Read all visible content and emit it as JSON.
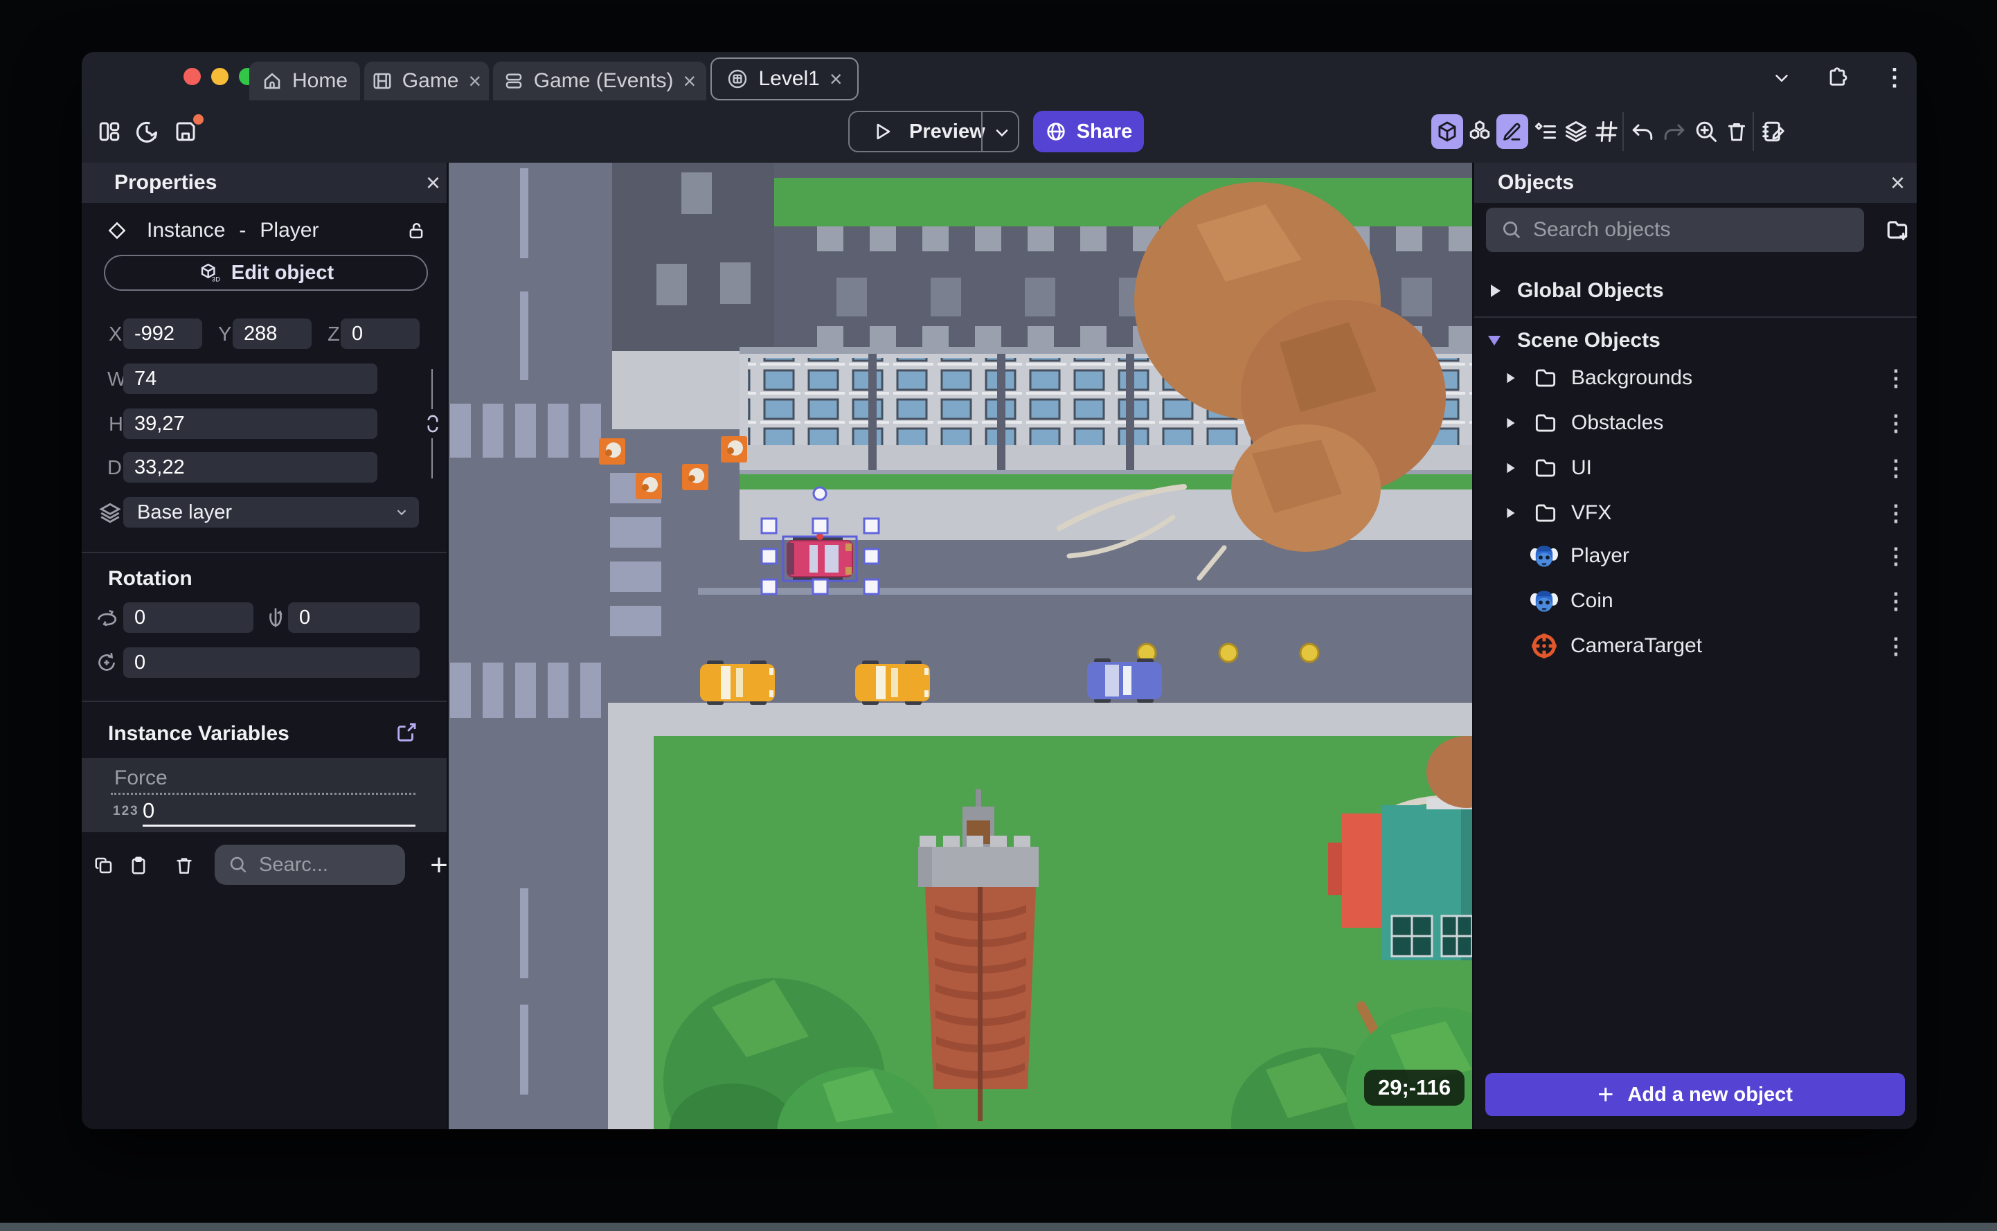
{
  "glyphs": {
    "close": "×",
    "kebab": "⋮",
    "plus": "+"
  },
  "titlebar": {
    "tabs": [
      {
        "label": "Home"
      },
      {
        "label": "Game"
      },
      {
        "label": "Game (Events)"
      },
      {
        "label": "Level1"
      }
    ]
  },
  "toolbar": {
    "preview": "Preview",
    "share": "Share"
  },
  "properties": {
    "title": "Properties",
    "instance_label": "Instance",
    "dash": "-",
    "object_name": "Player",
    "edit_object": "Edit object",
    "x_label": "X",
    "x_value": "-992",
    "y_label": "Y",
    "y_value": "288",
    "z_label": "Z",
    "z_value": "0",
    "w_label": "W",
    "w_value": "74",
    "h_label": "H",
    "h_value": "39,27",
    "d_label": "D",
    "d_value": "33,22",
    "layer_value": "Base layer",
    "rotation_title": "Rotation",
    "rotation_x": "0",
    "rotation_y": "0",
    "rotation_z": "0",
    "variables_title": "Instance Variables",
    "variable_name": "Force",
    "variable_type_badge": "123",
    "variable_value": "0",
    "search_placeholder": "Searc..."
  },
  "objects": {
    "title": "Objects",
    "search_placeholder": "Search objects",
    "global_section": "Global Objects",
    "scene_section": "Scene Objects",
    "folders": [
      "Backgrounds",
      "Obstacles",
      "UI",
      "VFX"
    ],
    "items": [
      "Player",
      "Coin",
      "CameraTarget"
    ],
    "add_button": "Add a new object"
  },
  "canvas": {
    "cursor_coords": "29;-116"
  },
  "colors": {
    "accent": "#5544d4",
    "accent_light": "#a89ef2",
    "save_indicator": "#f07350",
    "selection": "#5a5ed8",
    "grass": "#4fa24e",
    "road": "#6d7284",
    "sidewalk": "#c5c7ce",
    "brick": "#b05a3f",
    "teal_building": "#3da091",
    "car_pink": "#d6406f",
    "car_yellow": "#f0a829",
    "car_blue": "#6673d0",
    "cone": "#e8782a",
    "coin": "#e3c63e"
  }
}
